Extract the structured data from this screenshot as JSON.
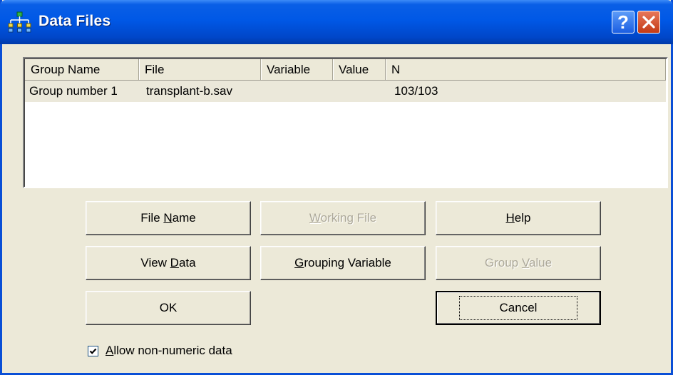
{
  "window": {
    "title": "Data Files",
    "help_button": "?"
  },
  "table": {
    "columns": [
      "Group Name",
      "File",
      "Variable",
      "Value",
      "N"
    ],
    "rows": [
      {
        "group_name": "Group number 1",
        "file": "transplant-b.sav",
        "variable": "",
        "value": "",
        "n": "103/103"
      }
    ]
  },
  "buttons": {
    "file_name": {
      "pre": "File ",
      "accel": "N",
      "post": "ame",
      "enabled": true
    },
    "working_file": {
      "pre": "",
      "accel": "W",
      "post": "orking File",
      "enabled": false
    },
    "help": {
      "pre": "",
      "accel": "H",
      "post": "elp",
      "enabled": true
    },
    "view_data": {
      "pre": "View ",
      "accel": "D",
      "post": "ata",
      "enabled": true
    },
    "grouping_variable": {
      "pre": "",
      "accel": "G",
      "post": "rouping Variable",
      "enabled": true
    },
    "group_value": {
      "pre": "Group ",
      "accel": "V",
      "post": "alue",
      "enabled": false
    },
    "ok": {
      "label": "OK",
      "enabled": true
    },
    "cancel": {
      "label": "Cancel",
      "enabled": true,
      "default": true
    }
  },
  "options": {
    "allow_non_numeric": {
      "checked": true,
      "pre": "",
      "accel": "A",
      "post": "llow non-numeric data"
    }
  }
}
